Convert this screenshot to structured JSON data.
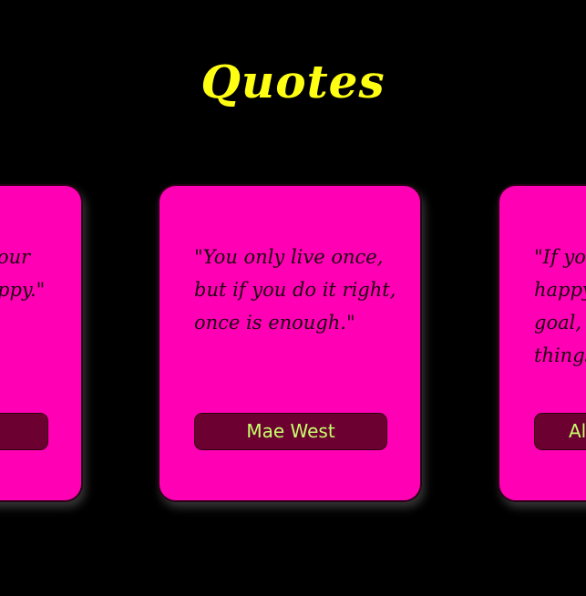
{
  "page": {
    "title": "Quotes"
  },
  "cards": {
    "left": {
      "quote_lines": [
        "our",
        "ppy.\""
      ],
      "author": ""
    },
    "center": {
      "quote_lines": [
        "\"You only live once,",
        "but if you do it right,",
        "once is enough.\""
      ],
      "author": "Mae West"
    },
    "right": {
      "quote_lines": [
        "\"If you",
        "happy",
        "goal, n",
        "things"
      ],
      "author": "Al"
    }
  },
  "colors": {
    "background": "#000000",
    "title": "#ffff14",
    "card": "#ff00b4",
    "button": "#6c0031",
    "button_text": "#c6ff6a"
  }
}
